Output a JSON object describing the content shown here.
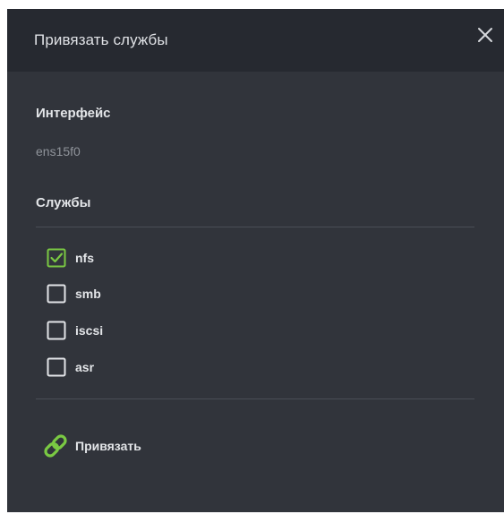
{
  "dialog": {
    "title": "Привязать службы",
    "interface_label": "Интерфейс",
    "interface_value": "ens15f0",
    "services_label": "Службы",
    "services": [
      {
        "label": "nfs",
        "checked": true
      },
      {
        "label": "smb",
        "checked": false
      },
      {
        "label": "iscsi",
        "checked": false
      },
      {
        "label": "asr",
        "checked": false
      }
    ],
    "bind_label": "Привязать"
  },
  "colors": {
    "accent": "#7ac943",
    "panel_bg": "#31343b",
    "header_bg": "#262930"
  },
  "icons": {
    "close": "close-icon",
    "bind": "link-icon",
    "checked": "checkbox-checked-icon",
    "unchecked": "checkbox-unchecked-icon"
  }
}
